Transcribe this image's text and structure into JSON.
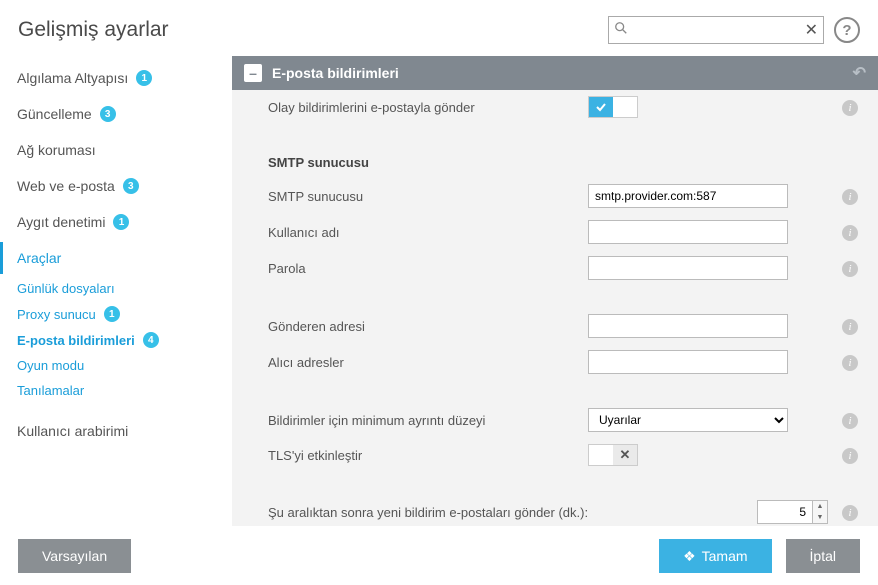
{
  "header": {
    "title": "Gelişmiş ayarlar",
    "search_placeholder": "",
    "search_value": "",
    "help_label": "?"
  },
  "sidebar": {
    "items": [
      {
        "label": "Algılama Altyapısı",
        "badge": "1"
      },
      {
        "label": "Güncelleme",
        "badge": "3"
      },
      {
        "label": "Ağ koruması",
        "badge": ""
      },
      {
        "label": "Web ve e-posta",
        "badge": "3"
      },
      {
        "label": "Aygıt denetimi",
        "badge": "1"
      },
      {
        "label": "Araçlar",
        "badge": ""
      }
    ],
    "sub": [
      {
        "label": "Günlük dosyaları",
        "badge": ""
      },
      {
        "label": "Proxy sunucu",
        "badge": "1"
      },
      {
        "label": "E-posta bildirimleri",
        "badge": "4"
      },
      {
        "label": "Oyun modu",
        "badge": ""
      },
      {
        "label": "Tanılamalar",
        "badge": ""
      }
    ],
    "last": {
      "label": "Kullanıcı arabirimi",
      "badge": ""
    }
  },
  "section": {
    "title": "E-posta bildirimleri",
    "rows": {
      "send_events": "Olay bildirimlerini e-postayla gönder",
      "smtp_header": "SMTP sunucusu",
      "smtp_server_label": "SMTP sunucusu",
      "smtp_server_value": "smtp.provider.com:587",
      "username_label": "Kullanıcı adı",
      "username_value": "",
      "password_label": "Parola",
      "password_value": "",
      "sender_label": "Gönderen adresi",
      "sender_value": "",
      "recipient_label": "Alıcı adresler",
      "recipient_value": "",
      "verbosity_label": "Bildirimler için minimum ayrıntı düzeyi",
      "verbosity_value": "Uyarılar",
      "tls_label": "TLS'yi etkinleştir",
      "interval_label": "Şu aralıktan sonra yeni bildirim e-postaları gönder (dk.):",
      "interval_value": "5"
    }
  },
  "footer": {
    "default": "Varsayılan",
    "ok": "Tamam",
    "cancel": "İptal"
  },
  "icons": {
    "search": "⌕",
    "clear": "✕",
    "check": "✓",
    "x": "✕",
    "revert": "↶",
    "shield": "❖"
  }
}
